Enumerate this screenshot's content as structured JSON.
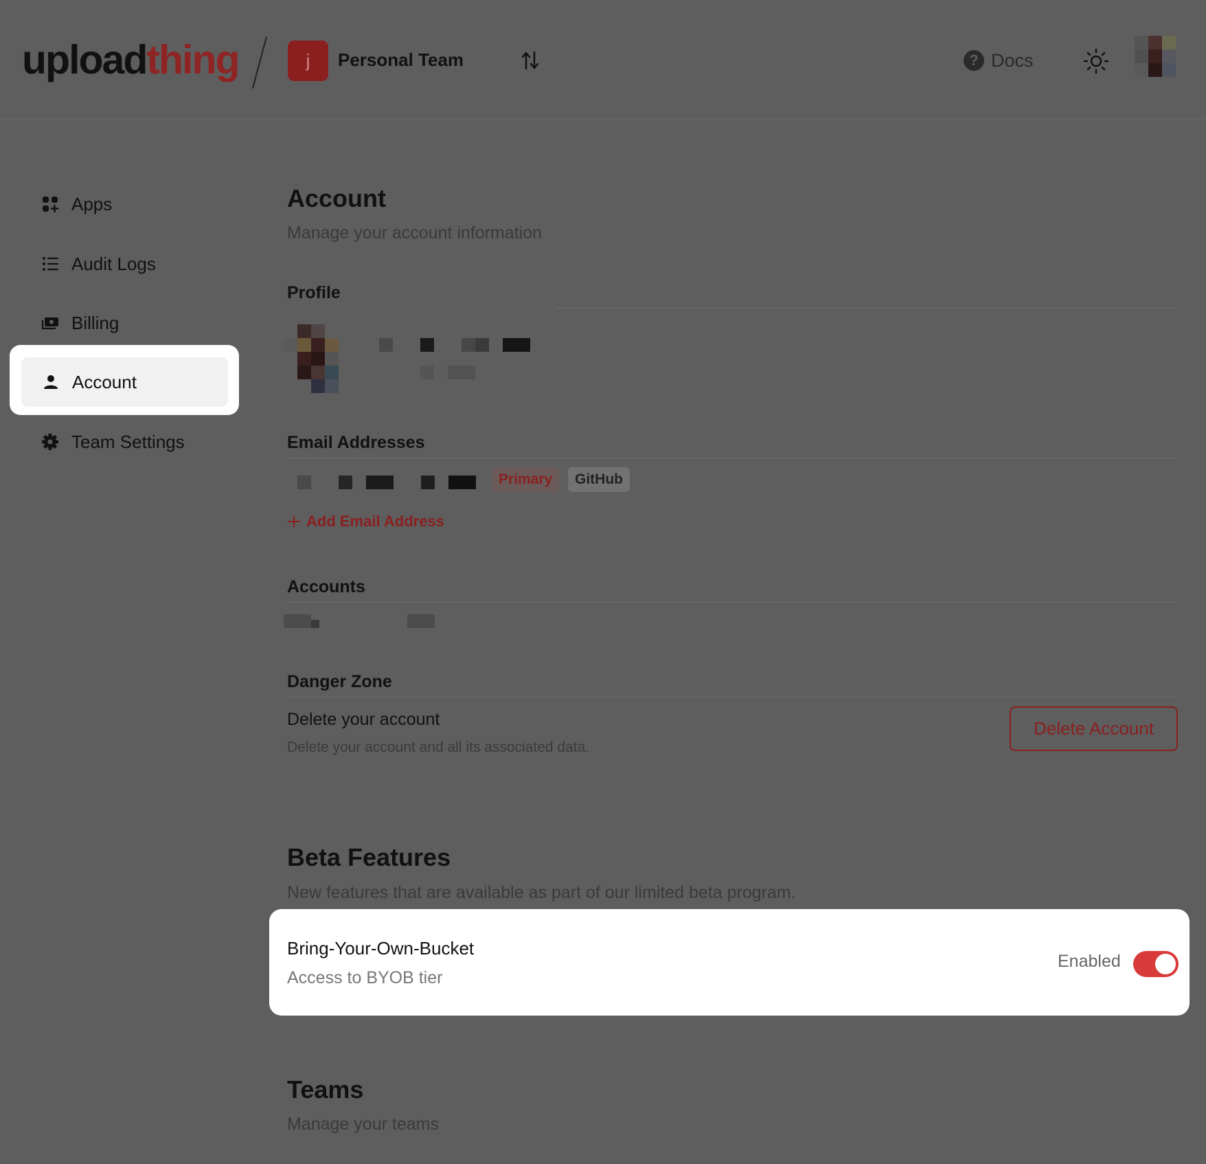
{
  "header": {
    "logo_part1": "upload",
    "logo_part2": "thing",
    "team_initial": "j",
    "team_name": "Personal Team",
    "docs_label": "Docs"
  },
  "sidebar": {
    "items": [
      {
        "label": "Apps",
        "icon": "apps-icon"
      },
      {
        "label": "Audit Logs",
        "icon": "list-icon"
      },
      {
        "label": "Billing",
        "icon": "money-icon"
      },
      {
        "label": "Account",
        "icon": "user-icon",
        "active": true
      },
      {
        "label": "Team Settings",
        "icon": "gear-icon"
      }
    ]
  },
  "account": {
    "title": "Account",
    "subtitle": "Manage your account information",
    "profile_title": "Profile",
    "email_title": "Email Addresses",
    "badge_primary": "Primary",
    "badge_github": "GitHub",
    "add_email": "Add Email Address",
    "accounts_title": "Accounts",
    "danger_title": "Danger Zone",
    "delete_heading": "Delete your account",
    "delete_desc": "Delete your account and all its associated data.",
    "delete_button": "Delete Account"
  },
  "beta": {
    "title": "Beta Features",
    "subtitle": "New features that are available as part of our limited beta program.",
    "feature_title": "Bring-Your-Own-Bucket",
    "feature_desc": "Access to BYOB tier",
    "feature_status": "Enabled",
    "feature_enabled": true
  },
  "teams": {
    "title": "Teams",
    "subtitle": "Manage your teams"
  },
  "colors": {
    "brand_red": "#8e2424",
    "toggle_on": "#d93a3a",
    "overlay": "#5e5e5e"
  }
}
